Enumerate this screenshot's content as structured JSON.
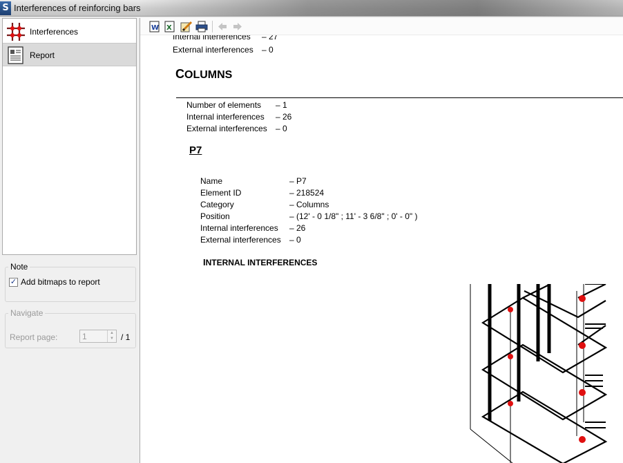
{
  "window": {
    "title": "Interferences of reinforcing bars",
    "app_icon_letter": "S"
  },
  "sidebar": {
    "items": [
      {
        "label": "Interferences",
        "icon": "interferences-icon",
        "selected": false
      },
      {
        "label": "Report",
        "icon": "report-icon",
        "selected": true
      }
    ]
  },
  "note": {
    "title": "Note",
    "checkbox_label": "Add bitmaps to report",
    "checked": true
  },
  "navigate": {
    "title": "Navigate",
    "page_label": "Report page:",
    "page_value": "1",
    "page_total": "/ 1"
  },
  "toolbar": {
    "buttons": [
      "export-word-icon",
      "export-excel-icon",
      "edit-icon",
      "print-icon",
      "back-arrow-icon",
      "forward-arrow-icon"
    ]
  },
  "report": {
    "top": {
      "internal_label": "Internal interferences",
      "internal_value": "– 27",
      "external_label": "External interferences",
      "external_value": "– 0"
    },
    "columns": {
      "heading_first": "C",
      "heading_rest": "OLUMNS",
      "rows": [
        {
          "label": "Number of elements",
          "value": "– 1"
        },
        {
          "label": "Internal interferences",
          "value": "– 26"
        },
        {
          "label": "External interferences",
          "value": "– 0"
        }
      ]
    },
    "element": {
      "title": "P7",
      "rows": [
        {
          "label": "Name",
          "value": "– P7"
        },
        {
          "label": "Element ID",
          "value": "– 218524"
        },
        {
          "label": "Category",
          "value": "– Columns"
        },
        {
          "label": "Position",
          "value": "– (12' - 0 1/8\" ; 11' - 3 6/8\" ; 0' - 0\" )"
        },
        {
          "label": "Internal interferences",
          "value": "– 26"
        },
        {
          "label": "External interferences",
          "value": "– 0"
        }
      ],
      "internal_heading_first": "I",
      "internal_heading_rest": "NTERNAL INTERFERENCES"
    }
  },
  "colors": {
    "interference_marker": "#e01010",
    "selection": "#dadada"
  }
}
